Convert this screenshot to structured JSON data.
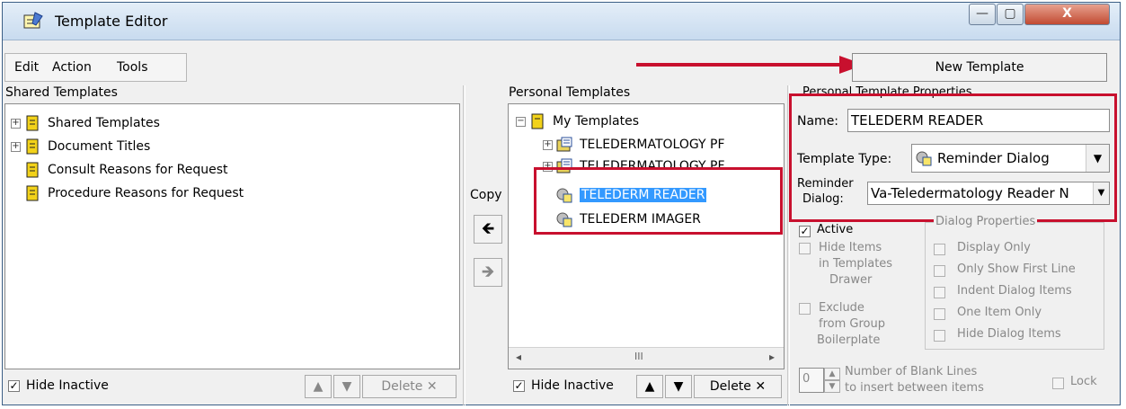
{
  "window": {
    "title": "Template Editor",
    "minimize": "—",
    "maximize": "▢",
    "close": "X"
  },
  "menu": {
    "edit": "Edit",
    "action": "Action",
    "tools": "Tools"
  },
  "toolbar": {
    "new_template": "New Template"
  },
  "shared": {
    "label": "Shared Templates",
    "items": [
      {
        "label": "Shared Templates",
        "expandable": true
      },
      {
        "label": "Document Titles",
        "expandable": true
      },
      {
        "label": "Consult Reasons for Request",
        "expandable": false
      },
      {
        "label": "Procedure Reasons for Request",
        "expandable": false
      }
    ],
    "hide_inactive": "Hide Inactive",
    "delete": "Delete"
  },
  "copy": {
    "label": "Copy",
    "left_arrow": "🡸",
    "right_arrow": "🡺"
  },
  "personal": {
    "label": "Personal Templates",
    "root": "My Templates",
    "items": [
      "TELEDERMATOLOGY PF",
      "TELEDERMATOLOGY PF",
      "TELEDERM READER",
      "TELEDERM IMAGER"
    ],
    "selected": "TELEDERM READER",
    "scroll_mid": "III",
    "hide_inactive": "Hide Inactive",
    "delete": "Delete"
  },
  "props": {
    "group_title": "Personal Template Properties",
    "name_label": "Name:",
    "name_value": "TELEDERM READER",
    "type_label": "Template Type:",
    "type_value": "Reminder Dialog",
    "reminder_label_1": "Reminder",
    "reminder_label_2": "Dialog:",
    "reminder_value": "Va-Teledermatology Reader N",
    "active": "Active",
    "hide_items": [
      "Hide Items",
      "in Templates",
      "Drawer"
    ],
    "exclude": [
      "Exclude",
      "from Group",
      "Boilerplate"
    ],
    "dialog_group": "Dialog Properties",
    "dialog_opts": [
      "Display Only",
      "Only Show First Line",
      "Indent Dialog Items",
      "One Item Only",
      "Hide Dialog Items"
    ],
    "blank_lines_value": "0",
    "blank_lines_label_1": "Number of Blank Lines",
    "blank_lines_label_2": "to insert between items",
    "lock": "Lock"
  }
}
